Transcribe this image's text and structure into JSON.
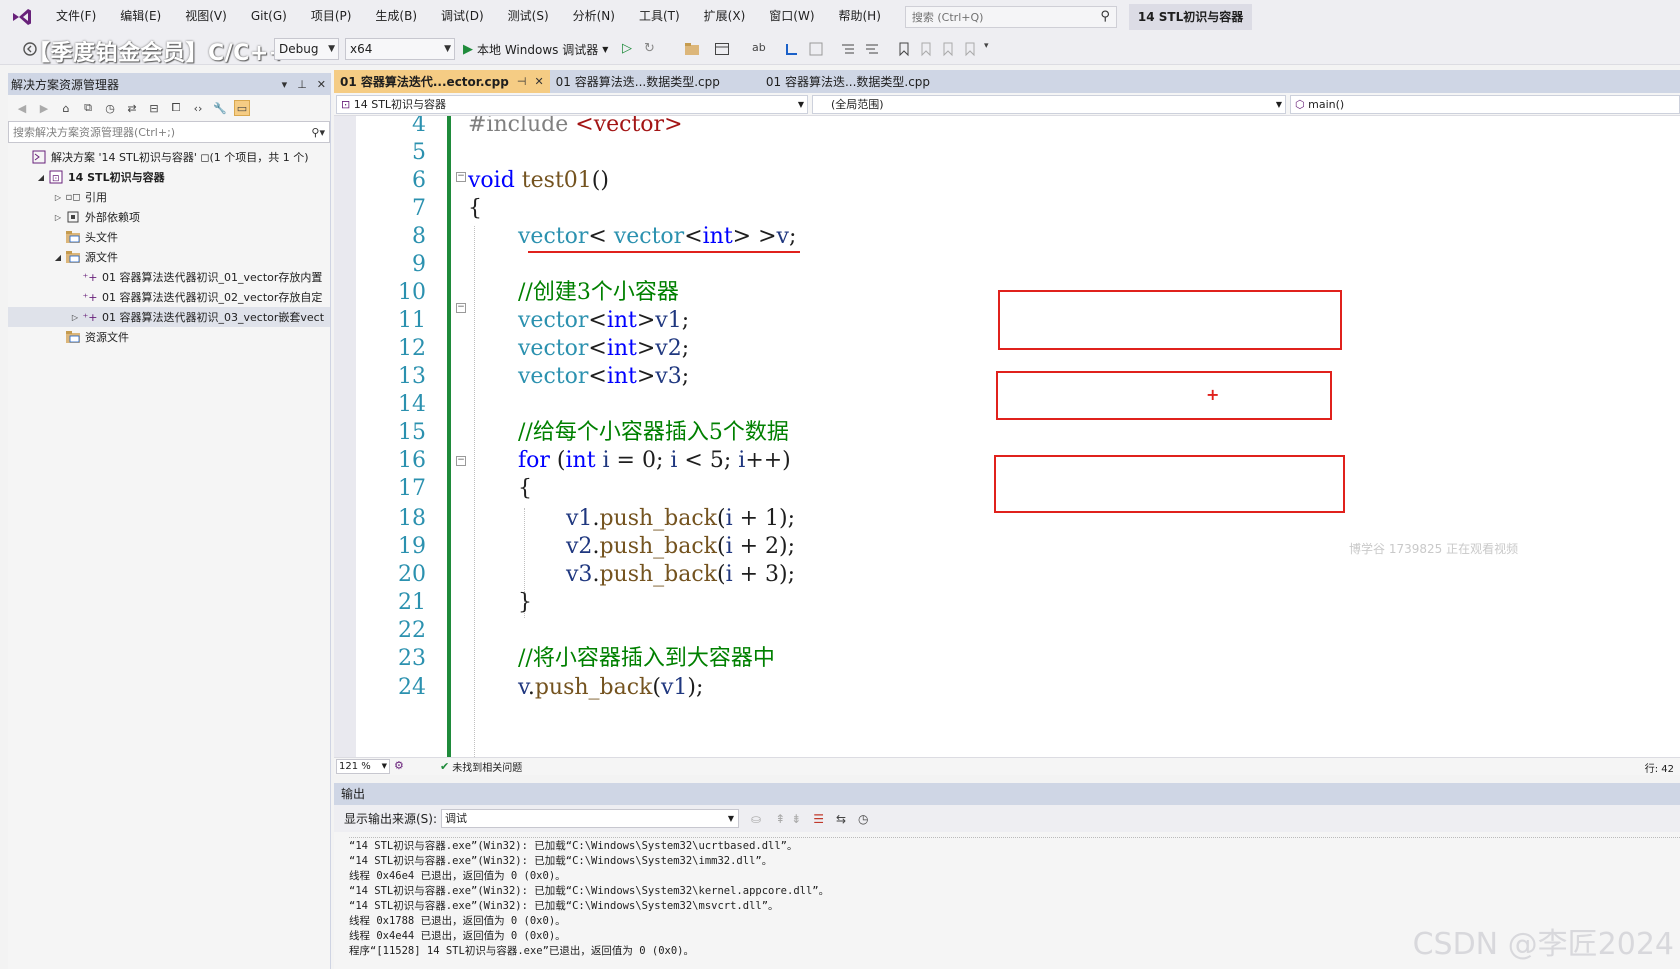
{
  "menubar": {
    "items": [
      "文件(F)",
      "编辑(E)",
      "视图(V)",
      "Git(G)",
      "项目(P)",
      "生成(B)",
      "调试(D)",
      "测试(S)",
      "分析(N)",
      "工具(T)",
      "扩展(X)",
      "窗口(W)",
      "帮助(H)"
    ],
    "search_placeholder": "搜索 (Ctrl+Q)",
    "solution_title": "14 STL初识与容器"
  },
  "toolbar": {
    "promo": "【季度铂金会员】C/C++",
    "config": "Debug",
    "platform": "x64",
    "run_label": "本地 Windows 调试器"
  },
  "solution_explorer": {
    "title": "解决方案资源管理器",
    "search_placeholder": "搜索解决方案资源管理器(Ctrl+;)",
    "tree": [
      {
        "label": "解决方案 '14 STL初识与容器' ◻(1 个项目，共 1 个)",
        "indent": 0,
        "expander": ""
      },
      {
        "label": "14 STL初识与容器",
        "indent": 1,
        "expander": "◢"
      },
      {
        "label": "引用",
        "indent": 2,
        "expander": "▷"
      },
      {
        "label": "外部依赖项",
        "indent": 2,
        "expander": "▷"
      },
      {
        "label": "头文件",
        "indent": 2,
        "expander": ""
      },
      {
        "label": "源文件",
        "indent": 2,
        "expander": "◢"
      },
      {
        "label": "01 容器算法迭代器初识_01_vector存放内置",
        "indent": 3,
        "expander": ""
      },
      {
        "label": "01 容器算法迭代器初识_02_vector存放自定",
        "indent": 3,
        "expander": ""
      },
      {
        "label": "01 容器算法迭代器初识_03_vector嵌套vect",
        "indent": 3,
        "expander": "▷"
      },
      {
        "label": "资源文件",
        "indent": 2,
        "expander": ""
      }
    ]
  },
  "editor": {
    "tabs": [
      "01 容器算法迭代...ector.cpp",
      "01 容器算法迭...数据类型.cpp",
      "01 容器算法迭...数据类型.cpp"
    ],
    "nav_project": "14 STL初识与容器",
    "nav_scope": "(全局范围)",
    "nav_member": "main()",
    "line_numbers": [
      "4",
      "5",
      "6",
      "7",
      "8",
      "9",
      "10",
      "11",
      "12",
      "13",
      "14",
      "15",
      "16",
      "17",
      "18",
      "19",
      "20",
      "21",
      "22",
      "23",
      "24"
    ],
    "code": {
      "l4_pp": "#include ",
      "l4_hdr": "<vector>",
      "l6_kw": "void",
      "l6_fn": " test01",
      "l6_rest": "()",
      "l7": "{",
      "l8_a": "vector",
      "l8_b": "< ",
      "l8_c": "vector",
      "l8_d": "<",
      "l8_e": "int",
      "l8_f": "> >",
      "l8_g": "v",
      "l8_h": ";",
      "l10": "//创建3个小容器",
      "l11_a": "vector",
      "l11_b": "<",
      "l11_c": "int",
      "l11_d": ">",
      "l11_e": "v1",
      "l11_f": ";",
      "l12_a": "vector",
      "l12_b": "<",
      "l12_c": "int",
      "l12_d": ">",
      "l12_e": "v2",
      "l12_f": ";",
      "l13_a": "vector",
      "l13_b": "<",
      "l13_c": "int",
      "l13_d": ">",
      "l13_e": "v3",
      "l13_f": ";",
      "l15": "//给每个小容器插入5个数据",
      "l16_for": "for",
      "l16_a": " (",
      "l16_int": "int",
      "l16_i": " i",
      "l16_b": " = 0; ",
      "l16_i2": "i",
      "l16_c": " < 5; ",
      "l16_i3": "i",
      "l16_d": "++)",
      "l17": "{",
      "l18_v": "v1",
      "l18_a": ".",
      "l18_f": "push_back",
      "l18_b": "(",
      "l18_i": "i",
      "l18_c": " + 1);",
      "l19_v": "v2",
      "l19_a": ".",
      "l19_f": "push_back",
      "l19_b": "(",
      "l19_i": "i",
      "l19_c": " + 2);",
      "l20_v": "v3",
      "l20_a": ".",
      "l20_f": "push_back",
      "l20_b": "(",
      "l20_i": "i",
      "l20_c": " + 3);",
      "l21": "}",
      "l23": "//将小容器插入到大容器中",
      "l24_v": "v",
      "l24_a": ".",
      "l24_f": "push_back",
      "l24_b": "(",
      "l24_v1": "v1",
      "l24_c": ");"
    },
    "watermark": "博学谷 1739825 正在观看视频",
    "zoom": "121 %",
    "issues": "未找到相关问题",
    "row_col": "行: 42"
  },
  "output": {
    "title": "输出",
    "source_label": "显示输出来源(S):",
    "source_value": "调试",
    "lines": [
      "“14 STL初识与容器.exe”(Win32): 已加载“C:\\Windows\\System32\\ucrtbased.dll”。",
      "“14 STL初识与容器.exe”(Win32): 已加载“C:\\Windows\\System32\\imm32.dll”。",
      "线程 0x46e4 已退出，返回值为 0 (0x0)。",
      "“14 STL初识与容器.exe”(Win32): 已加载“C:\\Windows\\System32\\kernel.appcore.dll”。",
      "“14 STL初识与容器.exe”(Win32): 已加载“C:\\Windows\\System32\\msvcrt.dll”。",
      "线程 0x1788 已退出，返回值为 0 (0x0)。",
      "线程 0x4e44 已退出，返回值为 0 (0x0)。",
      "程序“[11528] 14 STL初识与容器.exe”已退出，返回值为 0 (0x0)。"
    ],
    "csdn_watermark": "CSDN @李匠2024"
  },
  "colors": {
    "accent_tab": "#f5cc84",
    "panel_header": "#cfd6e5",
    "annotation_red": "#e0211c",
    "keyword": "#0000ff",
    "type": "#2b91af",
    "comment": "#008000"
  }
}
